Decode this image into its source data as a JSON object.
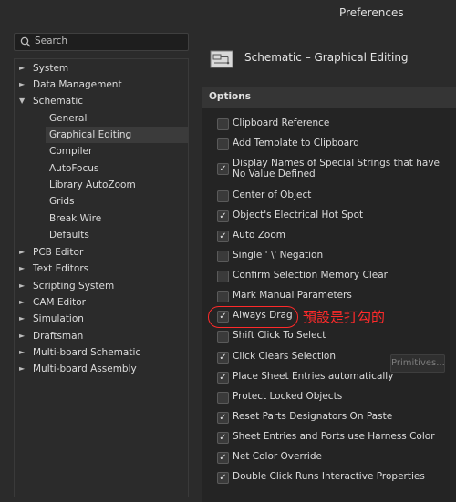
{
  "window": {
    "title": "Preferences"
  },
  "search": {
    "placeholder": "Search"
  },
  "tree": [
    {
      "label": "System",
      "expand": "►",
      "indent": 0
    },
    {
      "label": "Data Management",
      "expand": "►",
      "indent": 0
    },
    {
      "label": "Schematic",
      "expand": "▼",
      "indent": 0
    },
    {
      "label": "General",
      "indent": 1
    },
    {
      "label": "Graphical Editing",
      "indent": 1,
      "selected": true
    },
    {
      "label": "Compiler",
      "indent": 1
    },
    {
      "label": "AutoFocus",
      "indent": 1
    },
    {
      "label": "Library AutoZoom",
      "indent": 1
    },
    {
      "label": "Grids",
      "indent": 1
    },
    {
      "label": "Break Wire",
      "indent": 1
    },
    {
      "label": "Defaults",
      "indent": 1
    },
    {
      "label": "PCB Editor",
      "expand": "►",
      "indent": 0
    },
    {
      "label": "Text Editors",
      "expand": "►",
      "indent": 0
    },
    {
      "label": "Scripting System",
      "expand": "►",
      "indent": 0
    },
    {
      "label": "CAM Editor",
      "expand": "►",
      "indent": 0
    },
    {
      "label": "Simulation",
      "expand": "►",
      "indent": 0
    },
    {
      "label": "Draftsman",
      "expand": "►",
      "indent": 0
    },
    {
      "label": "Multi-board Schematic",
      "expand": "►",
      "indent": 0
    },
    {
      "label": "Multi-board Assembly",
      "expand": "►",
      "indent": 0
    }
  ],
  "page": {
    "title": "Schematic – Graphical Editing"
  },
  "options": {
    "header": "Options",
    "items": [
      {
        "label": "Clipboard Reference",
        "checked": false
      },
      {
        "label": "Add Template to Clipboard",
        "checked": false
      },
      {
        "label": "Display Names of Special Strings that have No Value Defined",
        "checked": true
      },
      {
        "label": "Center of Object",
        "checked": false
      },
      {
        "label": "Object's Electrical Hot Spot",
        "checked": true
      },
      {
        "label": "Auto Zoom",
        "checked": true
      },
      {
        "label": "Single ' \\' Negation",
        "checked": false
      },
      {
        "label": "Confirm Selection Memory Clear",
        "checked": false
      },
      {
        "label": "Mark Manual Parameters",
        "checked": false
      },
      {
        "label": "Always Drag",
        "checked": true
      },
      {
        "label": "Shift Click To Select",
        "checked": false
      },
      {
        "label": "Click Clears Selection",
        "checked": true
      },
      {
        "label": "Place Sheet Entries automatically",
        "checked": true
      },
      {
        "label": "Protect Locked Objects",
        "checked": false
      },
      {
        "label": "Reset Parts Designators On Paste",
        "checked": true
      },
      {
        "label": "Sheet Entries and Ports use Harness Color",
        "checked": true
      },
      {
        "label": "Net Color Override",
        "checked": true
      },
      {
        "label": "Double Click Runs Interactive Properties",
        "checked": true
      }
    ],
    "primitives_button": "Primitives..."
  },
  "annotation": {
    "text": "預設是打勾的",
    "color": "#ff2a2a"
  },
  "colors": {
    "background": "#2b2b2b",
    "panel": "#242424",
    "header": "#353535",
    "selection": "#3b3b3b"
  }
}
